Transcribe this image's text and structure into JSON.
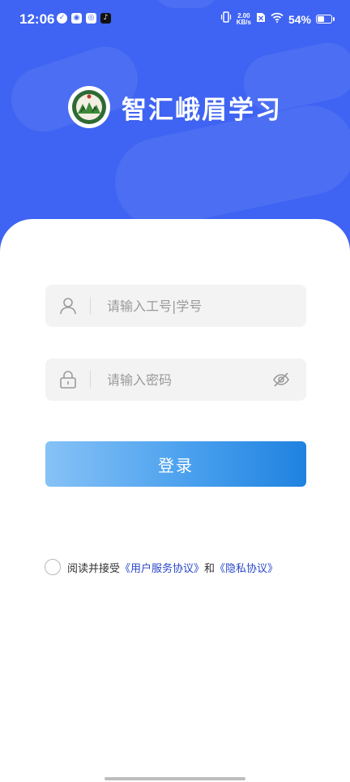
{
  "status_bar": {
    "time": "12:06",
    "net_speed_value": "2.00",
    "net_speed_unit": "KB/s",
    "battery_percent": "54%",
    "battery_level": 0.54,
    "notification_icons": [
      "check-circle-icon",
      "wechat-icon",
      "weibo-icon",
      "tiktok-icon"
    ]
  },
  "header": {
    "app_title": "智汇峨眉学习",
    "logo": "school-logo"
  },
  "login": {
    "username_placeholder": "请输入工号|学号",
    "password_placeholder": "请输入密码",
    "login_label": "登录"
  },
  "agreement": {
    "prefix": "阅读并接受",
    "user_agreement": "《用户服务协议》",
    "and": "和",
    "privacy_policy": "《隐私协议》"
  },
  "colors": {
    "header_blue": "#3f63f2",
    "button_start": "#86c2f6",
    "button_end": "#1f82e0",
    "link_blue": "#2a47c9"
  }
}
